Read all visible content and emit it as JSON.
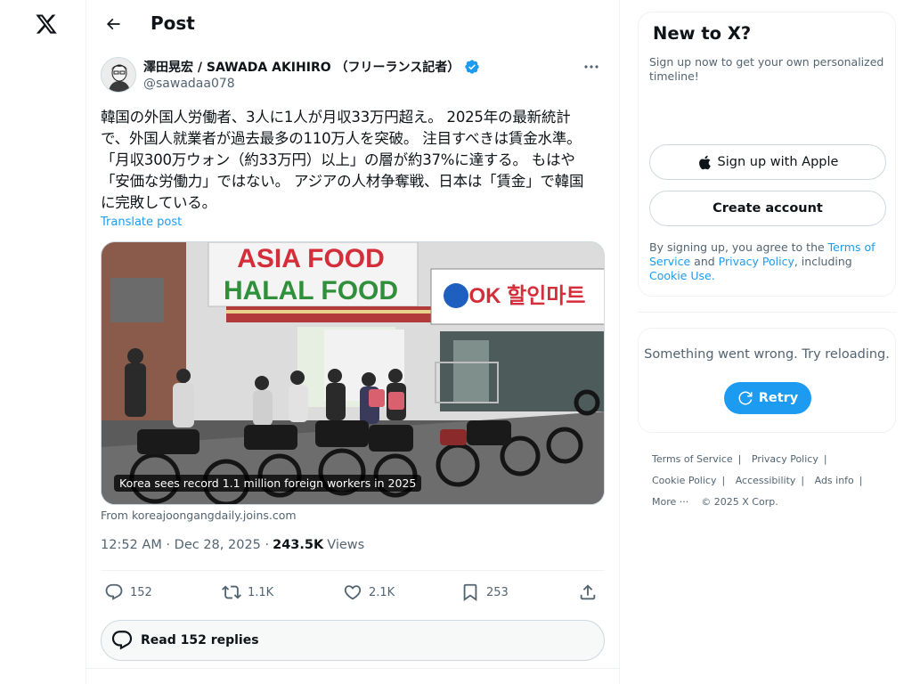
{
  "rail": {
    "logo_icon": "x-logo-icon"
  },
  "header": {
    "title": "Post",
    "back_icon": "arrow-left-icon"
  },
  "post": {
    "author": {
      "display_name": "澤田晃宏 / SAWADA AKIHIRO （フリーランス記者）",
      "handle": "@sawadaa078",
      "verified": true
    },
    "text": "韓国の外国人労働者、3人に1人が月収33万円超え。 2025年の最新統計\nで、外国人就業者が過去最多の110万人を突破。 注目すべきは賃金水準。\n「月収300万ウォン（約33万円）以上」の層が約37%に達する。 もはや\n「安価な労働力」ではない。 アジアの人材争奪戦、日本は「賃金」で韓国\nに完敗している。",
    "translate_label": "Translate post",
    "media": {
      "caption": "Korea sees record 1.1 million foreign workers in 2025",
      "source": "From koreajoongangdaily.joins.com",
      "sign_text_1": "ASIA FOOD",
      "sign_text_2": "HALAL FOOD",
      "sign_text_3": "OK 할인마트"
    },
    "timestamp": "12:52 AM · Dec 28, 2025",
    "views_count": "243.5K",
    "views_label": "Views",
    "actions": {
      "replies": "152",
      "reposts": "1.1K",
      "likes": "2.1K",
      "bookmarks": "253"
    },
    "read_replies_label": "Read 152 replies"
  },
  "sidebar": {
    "signup": {
      "title": "New to X?",
      "subtitle": "Sign up now to get your own personalized timeline!",
      "apple_button": "Sign up with Apple",
      "create_button": "Create account",
      "terms_prefix": "By signing up, you agree to the ",
      "terms_link": "Terms of Service",
      "and_text": " and ",
      "privacy_link": "Privacy Policy",
      "including_text": ", including ",
      "cookie_link": "Cookie Use."
    },
    "error": {
      "message": "Something went wrong. Try reloading.",
      "retry_label": "Retry"
    },
    "footer": {
      "terms": "Terms of Service",
      "privacy": "Privacy Policy",
      "cookie": "Cookie Policy",
      "accessibility": "Accessibility",
      "ads_info": "Ads info",
      "more": "More ···",
      "copyright": "© 2025 X Corp."
    }
  },
  "colors": {
    "accent": "#1d9bf0",
    "text_primary": "#0f1419",
    "text_secondary": "#536471",
    "border": "#eff3f4"
  }
}
